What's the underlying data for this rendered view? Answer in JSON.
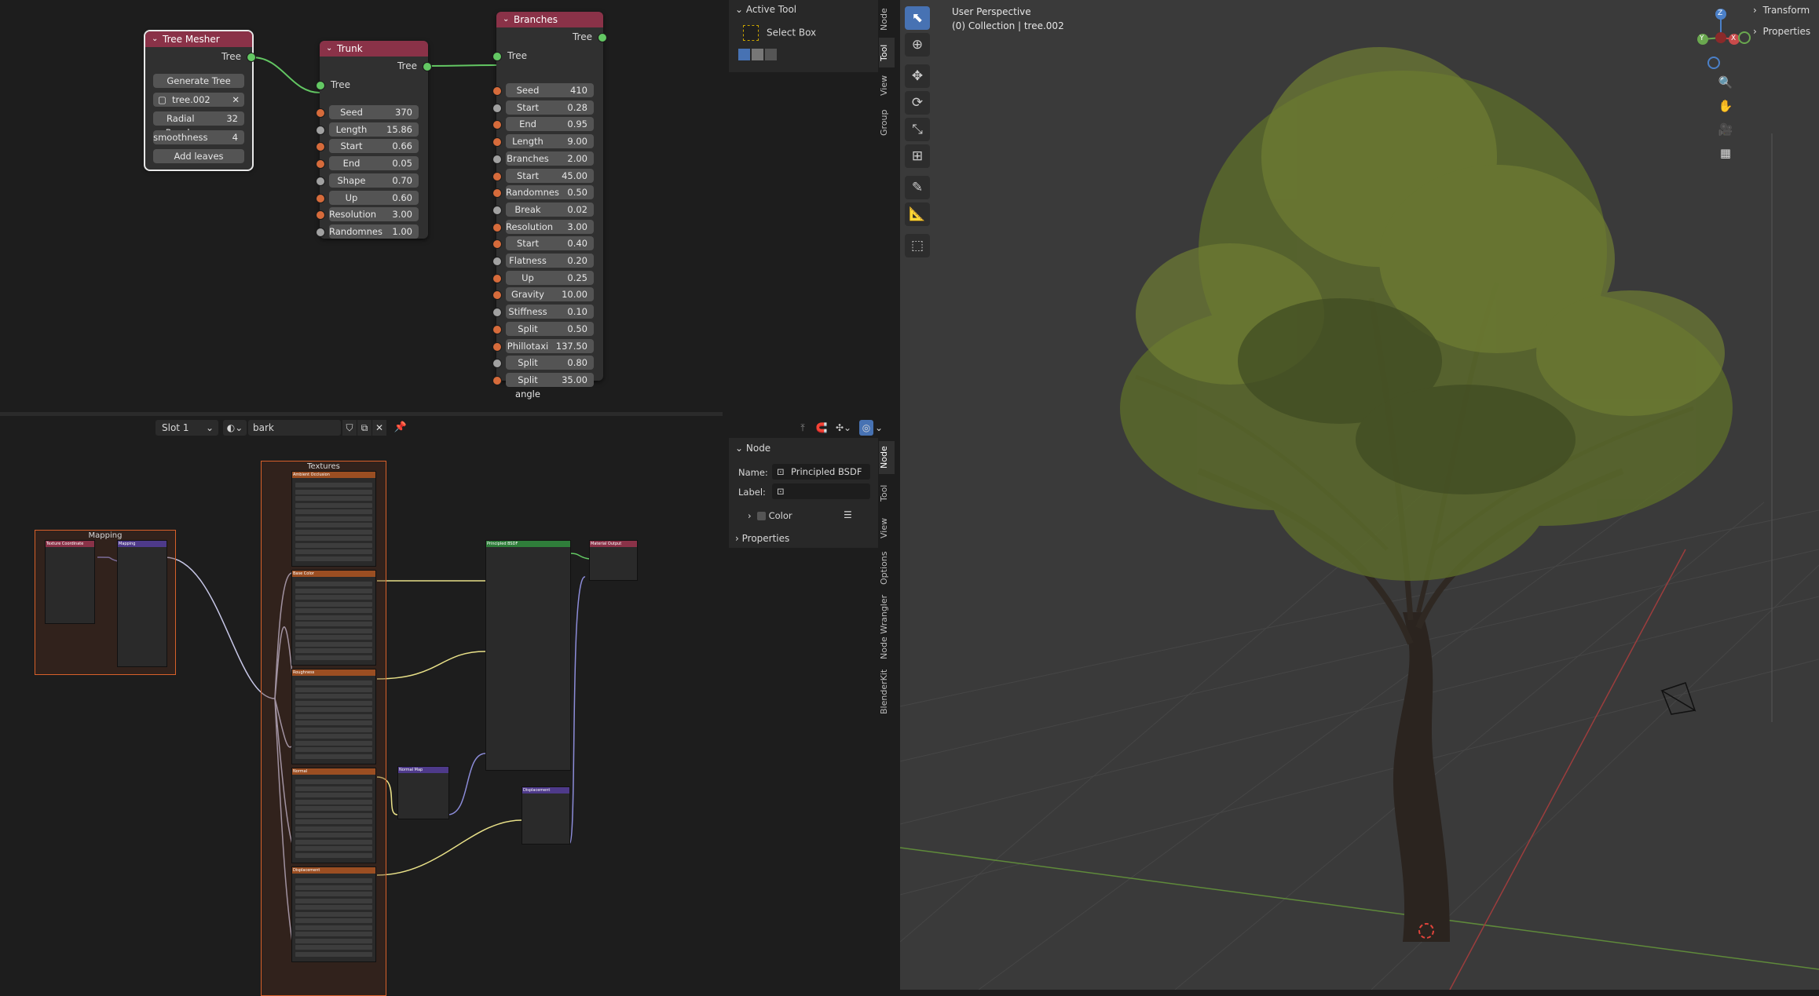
{
  "colors": {
    "accent": "#4772b3",
    "node_header_geometry": "#8a3248",
    "link_green": "#63c763",
    "texture_header": "#9b4e22",
    "frame_border": "#d7602a"
  },
  "top_editor": {
    "tree_mesher": {
      "title": "Tree Mesher",
      "out": "Tree",
      "generate": "Generate Tree",
      "object": "tree.002",
      "radial_label": "Radial Resolu",
      "radial_val": "32",
      "smooth_label": "smoothness",
      "smooth_val": "4",
      "add_leaves": "Add leaves"
    },
    "trunk": {
      "title": "Trunk",
      "out": "Tree",
      "in": "Tree",
      "fields": [
        {
          "label": "Seed",
          "value": "370"
        },
        {
          "label": "Length",
          "value": "15.86"
        },
        {
          "label": "Start Radius",
          "value": "0.66"
        },
        {
          "label": "End Radius",
          "value": "0.05"
        },
        {
          "label": "Shape",
          "value": "0.70"
        },
        {
          "label": "Up Attractio",
          "value": "0.60"
        },
        {
          "label": "Resolution",
          "value": "3.00"
        },
        {
          "label": "Randomnes",
          "value": "1.00"
        }
      ]
    },
    "branches": {
      "title": "Branches",
      "out": "Tree",
      "in": "Tree",
      "fields": [
        {
          "label": "Seed",
          "value": "410"
        },
        {
          "label": "Start",
          "value": "0.28"
        },
        {
          "label": "End",
          "value": "0.95"
        },
        {
          "label": "Length",
          "value": "9.00"
        },
        {
          "label": "Branches de",
          "value": "2.00"
        },
        {
          "label": "Start angle",
          "value": "45.00"
        },
        {
          "label": "Randomnes",
          "value": "0.50"
        },
        {
          "label": "Break Chan",
          "value": "0.02"
        },
        {
          "label": "Resolution",
          "value": "3.00"
        },
        {
          "label": "Start Radius",
          "value": "0.40"
        },
        {
          "label": "Flatness",
          "value": "0.20"
        },
        {
          "label": "Up Attractio",
          "value": "0.25"
        },
        {
          "label": "Gravity Str",
          "value": "10.00"
        },
        {
          "label": "Stiffness",
          "value": "0.10"
        },
        {
          "label": "Split proba",
          "value": "0.50"
        },
        {
          "label": "Phillotaxi",
          "value": "137.50"
        },
        {
          "label": "Split radius",
          "value": "0.80"
        },
        {
          "label": "Split angle",
          "value": "35.00"
        }
      ]
    }
  },
  "top_sidebar": {
    "panel": "Active Tool",
    "tool": "Select Box",
    "tabs": [
      "Node",
      "Tool",
      "View",
      "Group"
    ]
  },
  "bottom_header": {
    "slot": "Slot 1",
    "material": "bark"
  },
  "bottom_editor": {
    "textures_frame": "Textures",
    "mapping_frame": "Mapping",
    "texture_nodes": [
      "Ambient Occlusion",
      "Base Color",
      "Roughness",
      "Normal",
      "Displacement"
    ],
    "small_nodes": {
      "texcoord": "Texture Coordinate",
      "mapping": "Mapping",
      "bsdf": "Principled BSDF",
      "output": "Material Output",
      "normalmap": "Normal Map",
      "displacement": "Displacement"
    }
  },
  "bottom_sidebar": {
    "panel": "Node",
    "name_label": "Name:",
    "name_value": "Principled BSDF",
    "label_label": "Label:",
    "color": "Color",
    "properties": "Properties",
    "tabs": [
      "Node",
      "Tool",
      "View",
      "Options",
      "Node Wrangler",
      "BlenderKit"
    ]
  },
  "viewport": {
    "perspective": "User Perspective",
    "collection": "(0) Collection | tree.002",
    "side_tabs": [
      "Transform",
      "Properties"
    ],
    "gizmo": {
      "z": "Z",
      "y": "Y",
      "x": "X"
    }
  }
}
